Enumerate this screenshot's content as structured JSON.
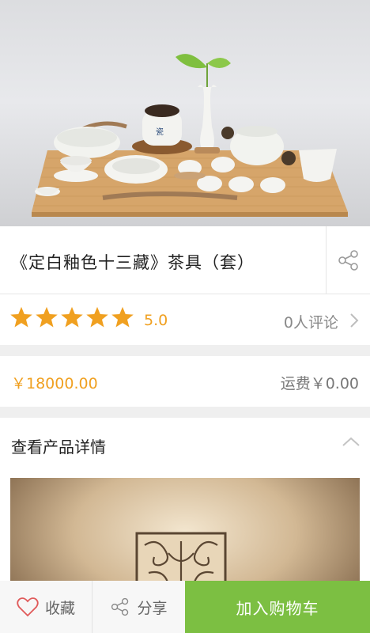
{
  "product": {
    "title": "《定白釉色十三藏》茶具（套）",
    "rating": 5.0,
    "rating_text": "5.0",
    "reviews_text": "0人评论",
    "price_text": "￥18000.00",
    "shipping_text": "运费￥0.00"
  },
  "details": {
    "header": "查看产品详情"
  },
  "bottom_bar": {
    "favorite_label": "收藏",
    "share_label": "分享",
    "add_to_cart_label": "加入购物车"
  },
  "icons": {
    "share": "share-icon",
    "star": "star-icon",
    "chevron_right": "chevron-right-icon",
    "chevron_up": "chevron-up-icon",
    "heart": "heart-icon"
  },
  "colors": {
    "accent": "#f0a020",
    "cart_button": "#7cbf42",
    "text_primary": "#222222",
    "text_secondary": "#888888"
  }
}
